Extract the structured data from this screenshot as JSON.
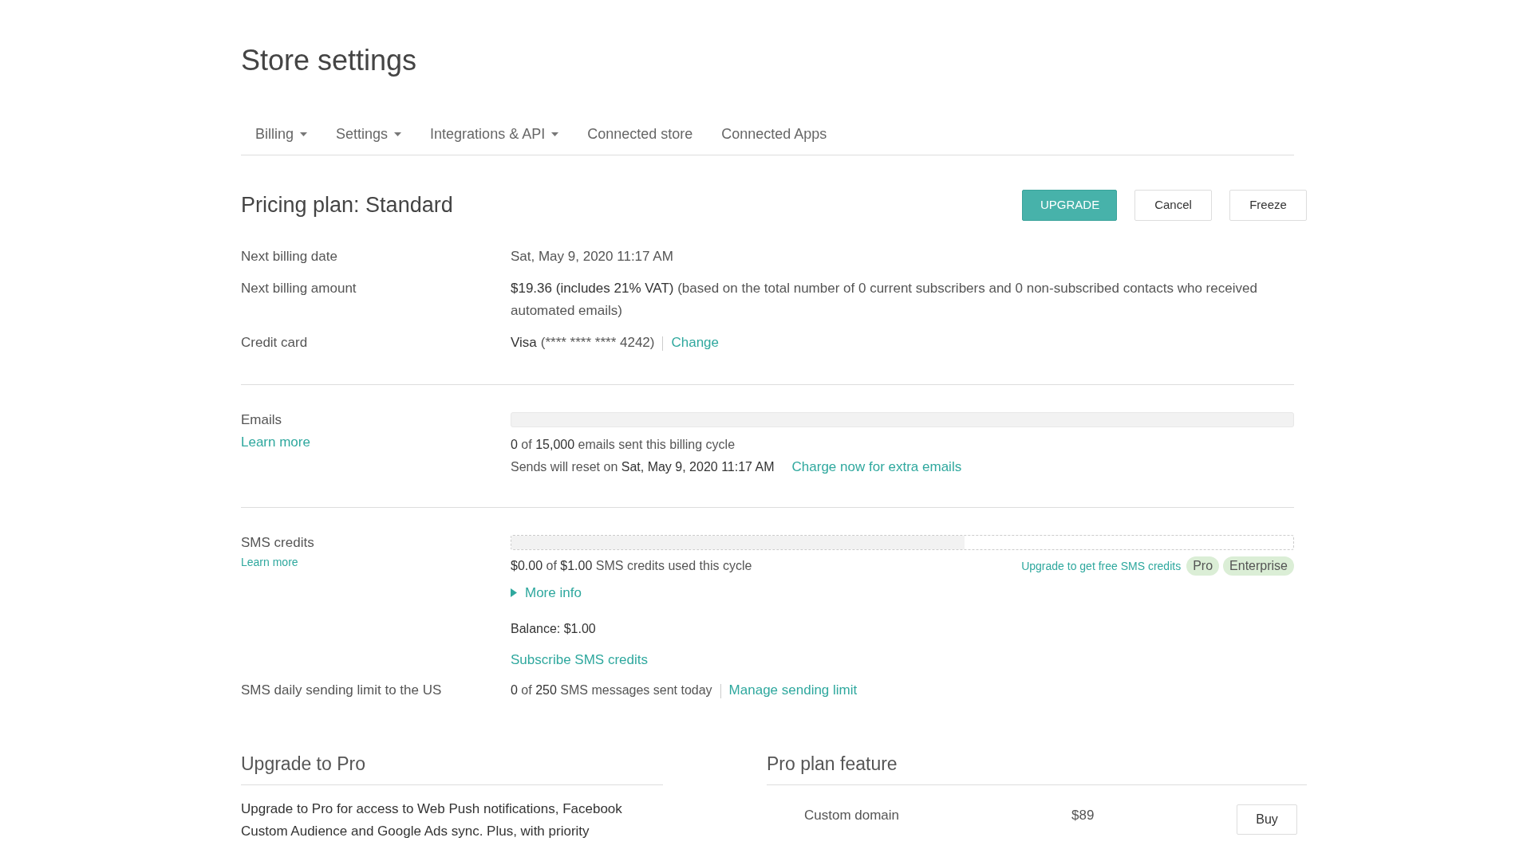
{
  "page_title": "Store settings",
  "tabs": [
    {
      "label": "Billing",
      "dropdown": true
    },
    {
      "label": "Settings",
      "dropdown": true
    },
    {
      "label": "Integrations & API",
      "dropdown": true
    },
    {
      "label": "Connected store",
      "dropdown": false
    },
    {
      "label": "Connected Apps",
      "dropdown": false
    }
  ],
  "plan": {
    "label": "Pricing plan:",
    "name": "Standard",
    "buttons": [
      {
        "label": "UPGRADE",
        "kind": "primary"
      },
      {
        "label": "Cancel",
        "kind": "outline"
      },
      {
        "label": "Freeze",
        "kind": "outline"
      }
    ]
  },
  "billing": [
    {
      "label": "Next billing date",
      "value": "Sat, May 9, 2020 11:17 AM"
    },
    {
      "label": "Next billing amount",
      "value": "**$19.36 (includes 21% VAT)** (based on the total number of 0 current subscribers and 0 non-subscribed contacts who received automated emails)"
    },
    {
      "label": "Credit card",
      "brand": "Visa",
      "number": "(**** **** **** 4242)",
      "link": "Change"
    }
  ],
  "emails": {
    "label": "Emails",
    "learn_more": "Learn more",
    "level": 0,
    "usage": "**0** of **15,000** emails sent this billing cycle",
    "reset": "Sends will reset on **Sat, May 9, 2020 11:17 AM**",
    "link": "Charge now for extra emails"
  },
  "sms": {
    "label": "SMS credits",
    "learn_more": "Learn more",
    "level": 0.58,
    "usage": "**$0.00** of **$1.00** SMS credits used this cycle",
    "upgrade_link": "Upgrade to get free SMS credits",
    "plan_badges": [
      "Pro",
      "Enterprise"
    ],
    "more_info": "More info",
    "expanded": false,
    "balance": "Balance: $1.00",
    "subscribe": "Subscribe SMS credits"
  },
  "sms_limit": {
    "label": "SMS daily sending limit to the US",
    "value": "**0** of **250** SMS messages sent today",
    "link": "Manage sending limit"
  },
  "upgrade": {
    "title": "Upgrade to Pro",
    "text": "Upgrade to Pro for access to Web Push notifications, Facebook Custom Audience and Google Ads sync. Plus, with priority"
  },
  "pro_features": {
    "title": "Pro plan feature",
    "items": [
      {
        "name": "Custom domain",
        "price": "$89",
        "button": "Buy"
      }
    ]
  }
}
